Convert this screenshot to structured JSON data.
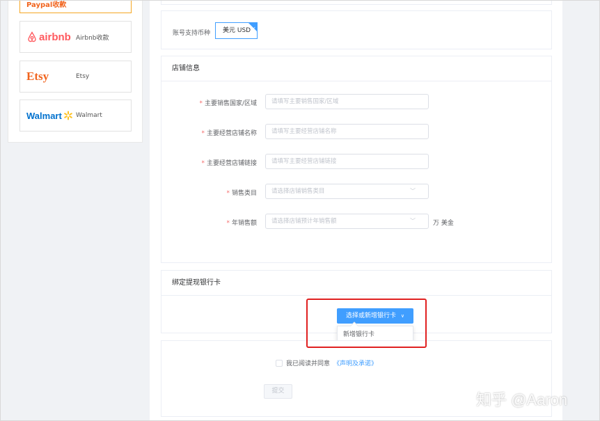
{
  "sidebar": {
    "items": [
      {
        "logo": "Paypal收款",
        "name": ""
      },
      {
        "logo": "airbnb",
        "name": "Airbnb收款"
      },
      {
        "logo": "Etsy",
        "name": "Etsy"
      },
      {
        "logo": "Walmart",
        "name": "Walmart"
      }
    ]
  },
  "currency": {
    "label": "账号支持币种",
    "value": "美元 USD"
  },
  "store_info": {
    "title": "店铺信息",
    "fields": [
      {
        "label": "主要销售国家/区域",
        "placeholder": "请填写主要销售国家/区域",
        "required": true,
        "type": "text"
      },
      {
        "label": "主要经营店铺名称",
        "placeholder": "请填写主要经营店铺名称",
        "required": true,
        "type": "text"
      },
      {
        "label": "主要经营店铺链接",
        "placeholder": "请填写主要经营店铺链接",
        "required": true,
        "type": "text"
      },
      {
        "label": "销售类目",
        "placeholder": "请选择店铺销售类目",
        "required": true,
        "type": "select"
      },
      {
        "label": "年销售额",
        "placeholder": "请选择店铺预计年销售额",
        "required": true,
        "type": "select",
        "suffix": "万 美金"
      }
    ]
  },
  "bank": {
    "title": "绑定提现银行卡",
    "button": "选择或新增银行卡",
    "dropdown_item": "新增银行卡"
  },
  "agreement": {
    "text": "我已阅读并同意",
    "link": "《声明及承诺》",
    "submit": "提交"
  },
  "watermark": "知乎 @Aaron",
  "colors": {
    "primary": "#409eff",
    "required": "#f56c6c",
    "highlight": "#e02020",
    "airbnb": "#ff5a5f",
    "etsy": "#f1641e",
    "walmart": "#0071ce"
  }
}
